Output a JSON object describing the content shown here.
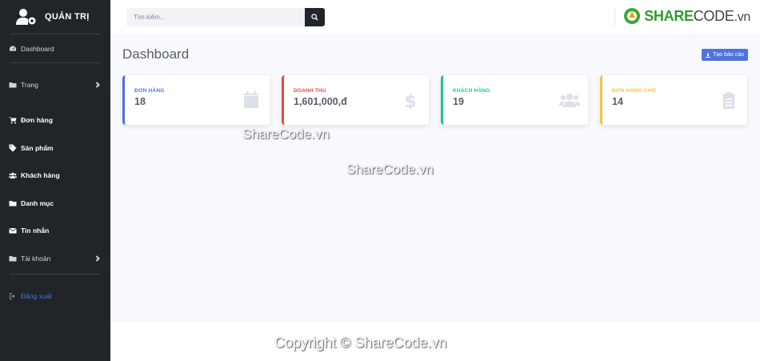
{
  "sidebar": {
    "brand": "QUẢN TRỊ",
    "items": [
      {
        "label": "Dashboard",
        "icon": "dashboard-icon"
      },
      {
        "label": "Trang",
        "icon": "folder-icon",
        "has_submenu": true
      },
      {
        "label": "Đơn hàng",
        "icon": "cart-icon"
      },
      {
        "label": "Sản phẩm",
        "icon": "tag-icon"
      },
      {
        "label": "Khách hàng",
        "icon": "users-icon"
      },
      {
        "label": "Danh mục",
        "icon": "folder-icon"
      },
      {
        "label": "Tin nhắn",
        "icon": "envelope-icon"
      },
      {
        "label": "Tài khoản",
        "icon": "folder-icon",
        "has_submenu": true
      }
    ],
    "logout": "Đăng xuất"
  },
  "topbar": {
    "search_placeholder": "Tìm kiếm...",
    "logo_share": "SHARE",
    "logo_code": "CODE",
    "logo_vn": ".vn"
  },
  "main": {
    "title": "Dashboard",
    "report_button": "Tạo báo cáo",
    "cards": [
      {
        "label": "ĐƠN HÀNG",
        "value": "18",
        "color": "#4e73df",
        "icon": "calendar-icon"
      },
      {
        "label": "DOANH THU",
        "value": "1,601,000,đ",
        "color": "#e74a3b",
        "icon": "dollar-icon"
      },
      {
        "label": "KHÁCH HÀNG",
        "value": "19",
        "color": "#1cc88a",
        "icon": "users-icon"
      },
      {
        "label": "ĐƠN HÀNG CHỜ",
        "value": "14",
        "color": "#f6c23e",
        "icon": "clipboard-icon"
      }
    ]
  },
  "watermarks": {
    "wm1": "ShareCode.vn",
    "wm2": "ShareCode.vn",
    "copyright": "Copyright © ShareCode.vn"
  }
}
